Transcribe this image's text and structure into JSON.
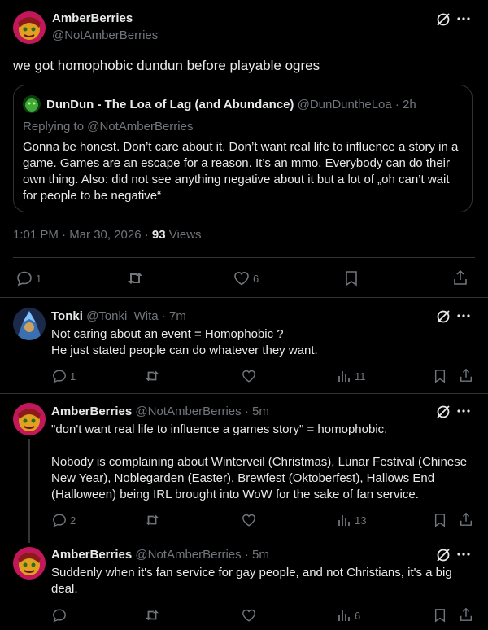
{
  "main_post": {
    "display_name": "AmberBerries",
    "handle": "@NotAmberBerries",
    "text": "we got homophobic dundun before playable ogres",
    "quote": {
      "display_name": "DunDun - The Loa of Lag (and Abundance)",
      "handle": "@DunDuntheLoa",
      "time": "· 2h",
      "replying_to": "Replying to @NotAmberBerries",
      "text": "Gonna be honest. Don’t care about it. Don’t want real life to influence a story in a game. Games are an escape for a reason. It’s an mmo. Everybody can do their own thing. Also: did not see anything negative about it but a lot of „oh can’t wait for people to be negative“"
    },
    "timestamp": "1:01 PM · Mar 30, 2026 ·",
    "views_count": "93",
    "views_label": "Views",
    "actions": {
      "replies": "1",
      "likes": "6"
    }
  },
  "replies": [
    {
      "display_name": "Tonki",
      "handle": "@Tonki_Wita",
      "time": "· 7m",
      "text": "Not caring about an event = Homophobic ?\nHe just stated people can do whatever they want.",
      "replies": "1",
      "reposts": "",
      "likes": "",
      "views": "11"
    },
    {
      "display_name": "AmberBerries",
      "handle": "@NotAmberBerries",
      "time": "· 5m",
      "text": "\"don't want real life to influence a games story\" = homophobic.\n\nNobody is complaining about Winterveil (Christmas), Lunar Festival (Chinese New Year), Noblegarden (Easter), Brewfest (Oktoberfest), Hallows End (Halloween) being IRL brought into WoW for the sake of fan service.",
      "replies": "2",
      "reposts": "",
      "likes": "",
      "views": "13"
    },
    {
      "display_name": "AmberBerries",
      "handle": "@NotAmberBerries",
      "time": "· 5m",
      "text": "Suddenly when it's fan service for gay people, and not Christians, it's a big deal.",
      "replies": "",
      "reposts": "",
      "likes": "",
      "views": "6"
    }
  ],
  "colors": {
    "background": "#000000",
    "text": "#e7e9ea",
    "muted": "#71767b",
    "border": "#2f3336"
  }
}
